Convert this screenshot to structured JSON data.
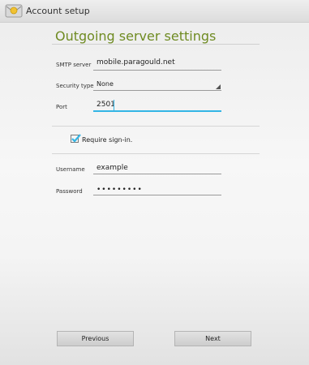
{
  "actionbar": {
    "icon": "email-envelope-icon",
    "title": "Account setup"
  },
  "screen": {
    "heading": "Outgoing server settings"
  },
  "form": {
    "smtp_server": {
      "label": "SMTP server",
      "value": "mobile.paragould.net"
    },
    "security_type": {
      "label": "Security type",
      "value": "None"
    },
    "port": {
      "label": "Port",
      "value": "2501"
    },
    "require_signin": {
      "label": "Require sign-in.",
      "checked": true
    },
    "username": {
      "label": "Username",
      "value": "example"
    },
    "password": {
      "label": "Password",
      "masked_value": "•••••••••"
    }
  },
  "buttons": {
    "previous": "Previous",
    "next": "Next"
  },
  "colors": {
    "heading": "#6f8b22",
    "focus_underline": "#33b5e5",
    "checkmark": "#33b5e5"
  }
}
